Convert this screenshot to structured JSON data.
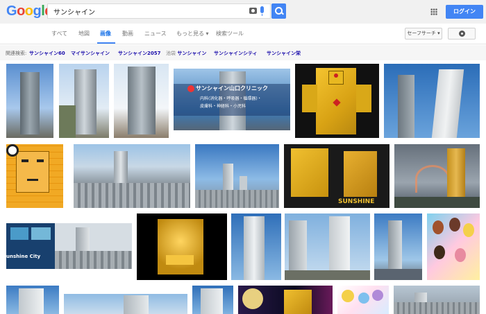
{
  "header": {
    "logo_letters": [
      "G",
      "o",
      "o",
      "g",
      "l",
      "e"
    ],
    "logo_colors": [
      "#4285f4",
      "#ea4335",
      "#fbbc05",
      "#4285f4",
      "#34a853",
      "#ea4335"
    ],
    "search_value": "サンシャイン",
    "login_label": "ログイン"
  },
  "tabs": [
    {
      "label": "すべて"
    },
    {
      "label": "地図"
    },
    {
      "label": "画像"
    },
    {
      "label": "動画"
    },
    {
      "label": "ニュース"
    },
    {
      "label": "もっと見る ▾"
    },
    {
      "label": "検索ツール"
    }
  ],
  "safe_search_label": "セーフサーチ ▾",
  "related": {
    "label": "関連検索:",
    "items": [
      {
        "text": "サンシャイン60"
      },
      {
        "text": "マイサンシャイン"
      },
      {
        "text": "サンシャイン2057"
      },
      {
        "prefix": "池袋",
        "text": " サンシャイン"
      },
      {
        "text": "サンシャインシティ"
      },
      {
        "text": "サンシャイン栄"
      }
    ]
  },
  "images": {
    "clinic_title": "サンシャイン山口クリニック",
    "clinic_sub1": "内科(消化器・呼吸器・循環器)・",
    "clinic_sub2": "皮膚科・神経科・小児科",
    "sunshine_label": "SUNSHINE",
    "sunshine_city_label": "unshine City"
  },
  "colors": {
    "accent": "#4285f4",
    "link": "#1a0dab"
  }
}
